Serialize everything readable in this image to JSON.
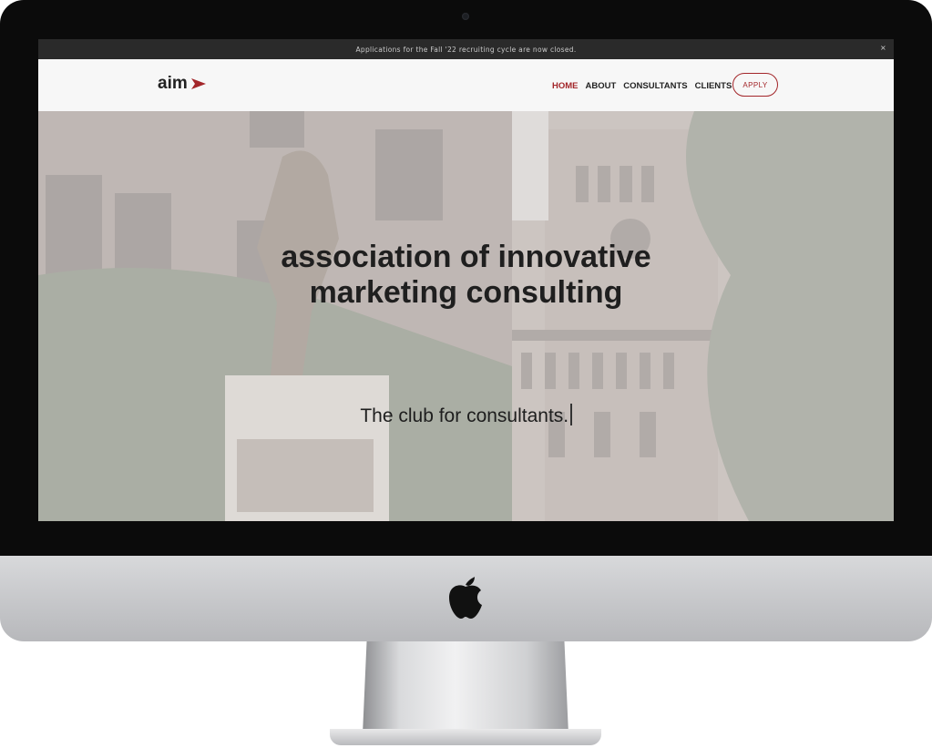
{
  "announcement": {
    "text": "Applications for the Fall '22 recruiting cycle are now closed.",
    "close_label": "×"
  },
  "navbar": {
    "logo_text": "aim",
    "logo_icon": "red-arrow-icon",
    "links": [
      {
        "label": "HOME",
        "active": true
      },
      {
        "label": "ABOUT",
        "active": false
      },
      {
        "label": "CONSULTANTS",
        "active": false
      },
      {
        "label": "CLIENTS",
        "active": false
      }
    ],
    "apply_label": "APPLY"
  },
  "hero": {
    "title_line1": "association of innovative",
    "title_line2": "marketing consulting",
    "tagline": "The club for consultants."
  },
  "device": {
    "logo_icon": "apple-icon"
  },
  "colors": {
    "accent": "#a3262a",
    "announcement_bg": "#2a2a2a",
    "nav_bg": "#f7f7f7",
    "text": "#1f1f1f"
  }
}
